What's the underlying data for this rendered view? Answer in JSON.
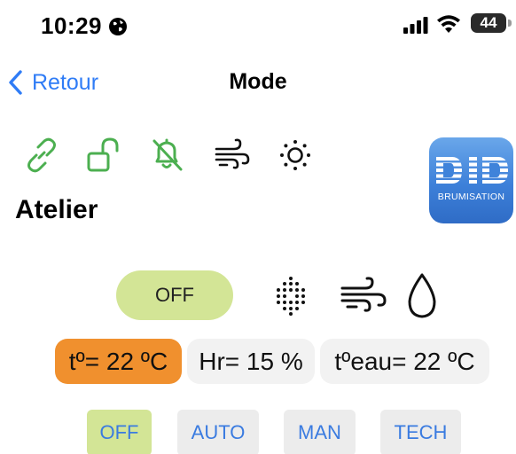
{
  "status_bar": {
    "time": "10:29",
    "battery": "44",
    "icons": [
      "globe-icon",
      "signal-icon",
      "wifi-icon",
      "battery-icon"
    ]
  },
  "nav": {
    "back_label": "Retour",
    "title": "Mode"
  },
  "status_icons": {
    "color": "#4caf50",
    "items": [
      "link-icon",
      "unlock-icon",
      "bell-slash-icon",
      "wind-icon",
      "sun-icon"
    ]
  },
  "logo": {
    "text": "DID",
    "subtitle": "BRUMISATION"
  },
  "zone": {
    "name": "Atelier"
  },
  "control": {
    "toggle_label": "OFF",
    "toggle_color": "#d3e596",
    "icons": [
      "mist-icon",
      "wind-icon",
      "drop-icon"
    ]
  },
  "readings": {
    "temperature": "tº= 22 ºC",
    "temperature_color": "#f0902e",
    "humidity": "Hr= 15 %",
    "water_temperature": "tºeau= 22 ºC"
  },
  "modes": {
    "off": "OFF",
    "auto": "AUTO",
    "man": "MAN",
    "tech": "TECH",
    "active": "OFF",
    "text_color": "#3a7be0"
  }
}
